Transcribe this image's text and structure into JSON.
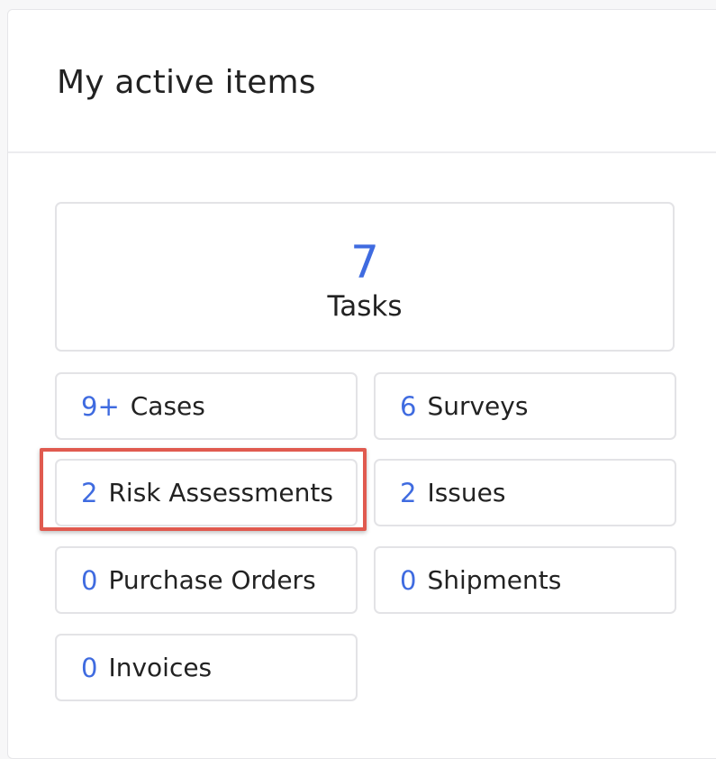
{
  "header": {
    "title": "My active items"
  },
  "tasks": {
    "count": "7",
    "label": "Tasks"
  },
  "items": [
    {
      "count": "9+",
      "label": "Cases"
    },
    {
      "count": "6",
      "label": "Surveys"
    },
    {
      "count": "2",
      "label": "Risk Assessments"
    },
    {
      "count": "2",
      "label": "Issues"
    },
    {
      "count": "0",
      "label": "Purchase Orders"
    },
    {
      "count": "0",
      "label": "Shipments"
    },
    {
      "count": "0",
      "label": "Invoices"
    }
  ],
  "colors": {
    "accent": "#3f6be0",
    "highlight": "#e05a4f",
    "text": "#222222",
    "border": "#e3e3e6"
  }
}
